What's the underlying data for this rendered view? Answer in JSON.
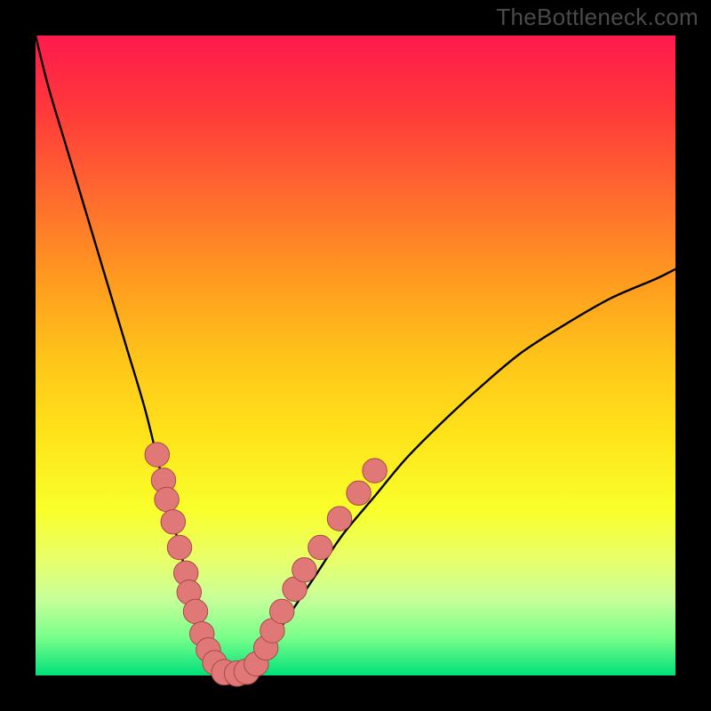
{
  "watermark": "TheBottleneck.com",
  "colors": {
    "background": "#000000",
    "gradient_top": "#ff1a4d",
    "gradient_bottom": "#00e07a",
    "curve": "#000000",
    "marker_fill": "#e07878",
    "marker_stroke": "#a84a4a"
  },
  "chart_data": {
    "type": "line",
    "title": "",
    "xlabel": "",
    "ylabel": "",
    "xlim": [
      0,
      100
    ],
    "ylim": [
      0,
      100
    ],
    "grid": false,
    "legend": false,
    "series": [
      {
        "name": "curve",
        "x": [
          0,
          2,
          5,
          8,
          11,
          14,
          17,
          19,
          21,
          23,
          24.5,
          26,
          27.5,
          29,
          31,
          33,
          35,
          37,
          40,
          44,
          48,
          53,
          58,
          64,
          70,
          76,
          83,
          90,
          97,
          100
        ],
        "y": [
          100,
          92,
          82,
          72,
          62,
          52,
          42,
          34,
          26,
          18,
          12,
          7,
          3,
          0.5,
          0,
          0.5,
          2.5,
          5.5,
          10,
          16,
          22,
          28,
          34,
          40,
          45.5,
          50.5,
          55,
          59,
          62,
          63.5
        ]
      }
    ],
    "markers": [
      {
        "x": 19.0,
        "y": 34.5,
        "r": 1.5
      },
      {
        "x": 20.0,
        "y": 30.5,
        "r": 1.5
      },
      {
        "x": 20.5,
        "y": 27.5,
        "r": 1.5
      },
      {
        "x": 21.5,
        "y": 24.0,
        "r": 1.5
      },
      {
        "x": 22.5,
        "y": 20.0,
        "r": 1.5
      },
      {
        "x": 23.5,
        "y": 16.0,
        "r": 1.5
      },
      {
        "x": 24.0,
        "y": 13.0,
        "r": 1.5
      },
      {
        "x": 25.0,
        "y": 10.0,
        "r": 1.5
      },
      {
        "x": 26.0,
        "y": 6.5,
        "r": 1.5
      },
      {
        "x": 27.0,
        "y": 4.0,
        "r": 1.5
      },
      {
        "x": 28.0,
        "y": 2.0,
        "r": 1.5
      },
      {
        "x": 29.5,
        "y": 0.5,
        "r": 1.6
      },
      {
        "x": 31.5,
        "y": 0.3,
        "r": 1.6
      },
      {
        "x": 33.0,
        "y": 0.6,
        "r": 1.6
      },
      {
        "x": 34.5,
        "y": 1.8,
        "r": 1.5
      },
      {
        "x": 36.0,
        "y": 4.3,
        "r": 1.5
      },
      {
        "x": 37.0,
        "y": 7.0,
        "r": 1.5
      },
      {
        "x": 38.5,
        "y": 10.0,
        "r": 1.5
      },
      {
        "x": 40.5,
        "y": 13.5,
        "r": 1.5
      },
      {
        "x": 42.0,
        "y": 16.5,
        "r": 1.5
      },
      {
        "x": 44.5,
        "y": 20.0,
        "r": 1.5
      },
      {
        "x": 47.5,
        "y": 24.5,
        "r": 1.5
      },
      {
        "x": 50.5,
        "y": 28.5,
        "r": 1.5
      },
      {
        "x": 53.0,
        "y": 32.0,
        "r": 1.5
      }
    ]
  }
}
